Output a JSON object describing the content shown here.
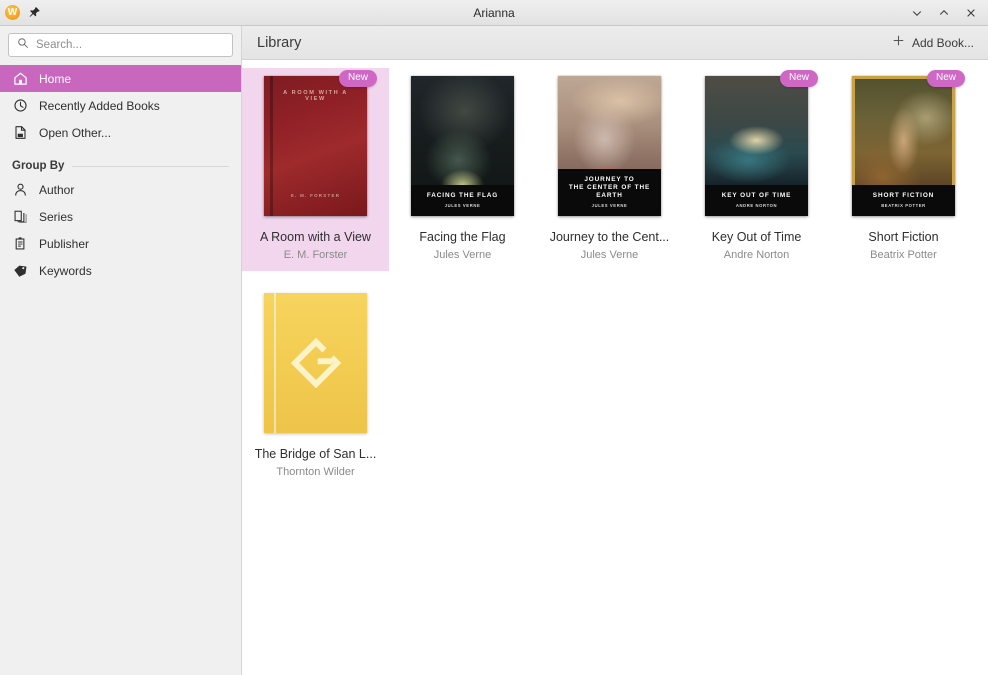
{
  "window": {
    "title": "Arianna",
    "app_logo_letter": "W",
    "controls": [
      {
        "name": "minimize",
        "glyph": "∨"
      },
      {
        "name": "maximize",
        "glyph": "∧"
      },
      {
        "name": "close",
        "glyph": "✕"
      }
    ]
  },
  "sidebar": {
    "search": {
      "placeholder": "Search...",
      "value": ""
    },
    "nav": [
      {
        "id": "home",
        "label": "Home",
        "icon": "home-icon",
        "active": true
      },
      {
        "id": "recently-added-books",
        "label": "Recently Added Books",
        "icon": "clock-icon",
        "active": false
      },
      {
        "id": "open-other",
        "label": "Open Other...",
        "icon": "file-open-icon",
        "active": false
      }
    ],
    "group_by": {
      "header": "Group By",
      "items": [
        {
          "id": "author",
          "label": "Author",
          "icon": "person-icon"
        },
        {
          "id": "series",
          "label": "Series",
          "icon": "stacked-pages-icon"
        },
        {
          "id": "publisher",
          "label": "Publisher",
          "icon": "clipboard-icon"
        },
        {
          "id": "keywords",
          "label": "Keywords",
          "icon": "tag-icon"
        }
      ]
    }
  },
  "header": {
    "title": "Library",
    "add_book_label": "Add Book...",
    "add_book_icon": "plus-icon"
  },
  "accent_colors": {
    "selection": "#c867bd",
    "selection_tint": "#f2d6ee",
    "badge": "#cf68c4",
    "sidebar_bg": "#f0f0f0",
    "header_bg": "#e8e8e8"
  },
  "library": {
    "badge_new_label": "New",
    "books": [
      {
        "title": "A Room with a View",
        "author": "E. M. Forster",
        "cover_style": "red-classic",
        "cover_title_text": "A ROOM WITH A VIEW",
        "cover_author_text": "E. M. FORSTER",
        "badge": "new",
        "selected": true
      },
      {
        "title": "Facing the Flag",
        "author": "Jules Verne",
        "cover_style": "art-flag",
        "cover_title_text": "FACING THE FLAG",
        "cover_author_text": "JULES VERNE",
        "badge": "sliver",
        "selected": false
      },
      {
        "title": "Journey to the Cent...",
        "author": "Jules Verne",
        "cover_style": "art-journey",
        "cover_title_text": "JOURNEY TO\nTHE CENTER OF THE EARTH",
        "cover_author_text": "JULES VERNE",
        "badge": "sliver",
        "selected": false
      },
      {
        "title": "Key Out of Time",
        "author": "Andre Norton",
        "cover_style": "art-key",
        "cover_title_text": "KEY OUT OF TIME",
        "cover_author_text": "ANDRE NORTON",
        "badge": "new",
        "selected": false
      },
      {
        "title": "Short Fiction",
        "author": "Beatrix Potter",
        "cover_style": "art-short",
        "cover_title_text": "SHORT FICTION",
        "cover_author_text": "BEATRIX POTTER",
        "badge": "new",
        "selected": false
      },
      {
        "title": "The Bridge of San L...",
        "author": "Thornton Wilder",
        "cover_style": "epub-placeholder",
        "cover_title_text": "",
        "cover_author_text": "",
        "badge": "none",
        "selected": false
      }
    ]
  }
}
